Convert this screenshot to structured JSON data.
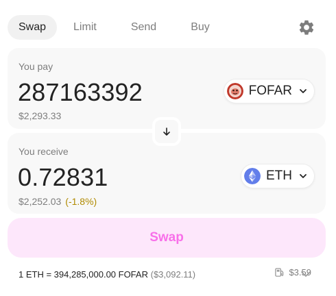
{
  "tabs": [
    {
      "label": "Swap"
    },
    {
      "label": "Limit"
    },
    {
      "label": "Send"
    },
    {
      "label": "Buy"
    }
  ],
  "pay": {
    "label": "You pay",
    "amount": "287163392",
    "usd": "$2,293.33",
    "token": {
      "symbol": "FOFAR",
      "icon": "fofar-token-icon"
    }
  },
  "receive": {
    "label": "You receive",
    "amount": "0.72831",
    "usd": "$2,252.03",
    "change": "(-1.8%)",
    "token": {
      "symbol": "ETH",
      "icon": "eth-token-icon"
    }
  },
  "swap_button": {
    "label": "Swap"
  },
  "footer": {
    "rate": "1 ETH = 394,285,000.00 FOFAR",
    "rate_usd": "($3,092.11)",
    "gas": "$3.59"
  },
  "colors": {
    "accent": "#f870e9",
    "swap_bg": "#fde7fb",
    "panel_bg": "#f8f8f8",
    "muted": "#7d7d7d",
    "warning": "#b08a00",
    "eth": "#627eea"
  }
}
